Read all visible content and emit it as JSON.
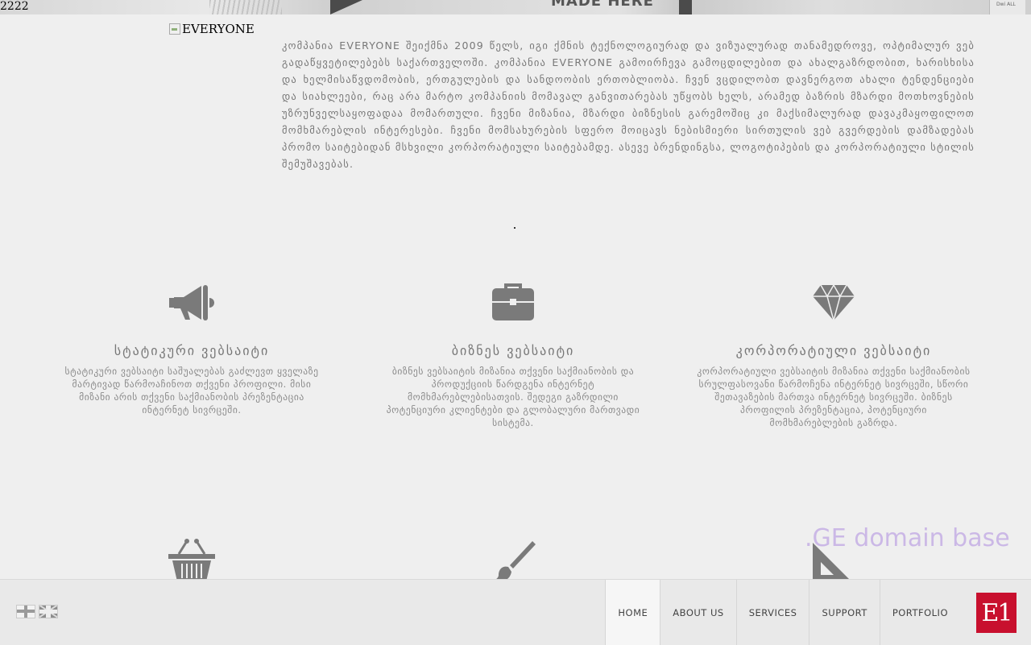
{
  "hero": {
    "debug_text": "2222",
    "banner_text": "MADE HERE",
    "side_card_text": "Dwi\nALL"
  },
  "logo": {
    "alt": "EVERYONE"
  },
  "intro": {
    "text": "კომპანია EVERYONE შეიქმნა 2009 წელს, იგი ქმნის ტექნოლოგიურად და ვიზუალურად თანამედროვე, ოპტიმალურ ვებ გადაწყვეტილებებს საქართველოში. კომპანია EVERYONE გამოირჩევა გამოცდილებით და ახალგაზრდობით, ხარისხისა და ხელმისაწვდომობის, ერთგულების და სანდოობის ერთობლიობა. ჩვენ ვცდილობთ დავნერგოთ ახალი ტენდენციები და სიახლეები, რაც არა მარტო კომპანიის მომავალ განვითარებას უწყობს ხელს, არამედ ბაზრის მზარდი მოთხოვნების უზრუნველსაყოფადაა მომართული. ჩვენი მიზანია, მზარდი ბიზნესის გარემოშიც კი მაქსიმალურად დავაკმაყოფილოთ მომხმარებლის ინტერესები. ჩვენი მომსახურების სფერო მოიცავს ნებისმიერი სირთულის ვებ გვერდების დამზადებას პრომო საიტებიდან მსხვილი კორპორატიული საიტებამდე. ასევე ბრენდინგსა, ლოგოტიპების და კორპორატიული სტილის შემუშავებას."
  },
  "services": [
    {
      "icon": "megaphone-icon",
      "title": "სტატიკური ვებსაიტი",
      "desc": "სტატიკური ვებსაიტი საშუალებას გაძლევთ ყველაზე მარტივად წარმოაჩინოთ თქვენი პროფილი. მისი მიზანი არის თქვენი საქმიანობის პრეზენტაცია ინტერნეტ სივრცეში."
    },
    {
      "icon": "briefcase-icon",
      "title": "ბიზნეს ვებსაიტი",
      "desc": "ბიზნეს ვებსაიტის მიზანია თქვენი საქმიანობის და პროდუქციის წარდგენა ინტერნეტ მომხმარებლებისათვის. შედეგი გაზრდილი პოტენციური კლიენტები და გლობალური მართვადი სისტემა."
    },
    {
      "icon": "diamond-icon",
      "title": "კორპორატიული ვებსაიტი",
      "desc": "კორპორატიული ვებსაიტის მიზანია თქვენი საქმიანობის სრულფასოვანი წარმოჩენა ინტერნეტ სივრცეში, სწორი შეთავაზების მართვა ინტერნეტ სივრცეში. ბიზნეს პროფილის პრეზენტაცია, პოტენციური მომხმარებლების გაზრდა."
    }
  ],
  "services_row2_icons": [
    "basket-icon",
    "brush-icon",
    "set-square-icon"
  ],
  "watermark": ".GE domain base",
  "footer": {
    "nav": [
      "HOME",
      "ABOUT US",
      "SERVICES",
      "SUPPORT",
      "PORTFOLIO"
    ],
    "active": "HOME",
    "brand": "E1"
  }
}
